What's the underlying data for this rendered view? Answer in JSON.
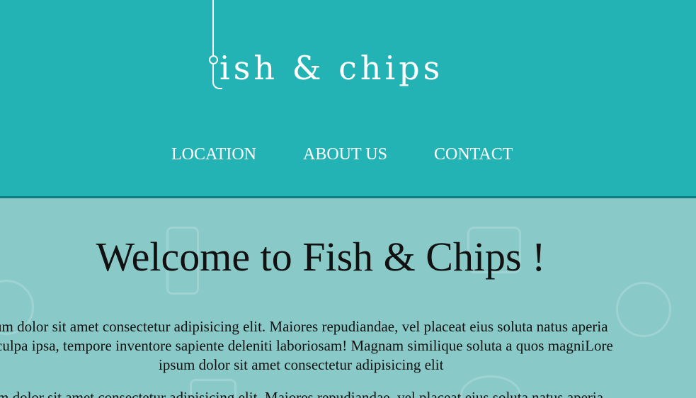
{
  "header": {
    "logo_text": "ish & chips",
    "brand_color": "#24b3b5",
    "border_color": "#137c80"
  },
  "nav": {
    "items": [
      {
        "label": "LOCATION"
      },
      {
        "label": "ABOUT US"
      },
      {
        "label": "CONTACT"
      }
    ]
  },
  "main": {
    "background_color": "#89cac8",
    "title": "Welcome to Fish & Chips !",
    "paragraph_lines": [
      "um dolor sit amet consectetur adipisicing elit. Maiores repudiandae, vel placeat eius soluta natus aperia",
      "culpa ipsa, tempore inventore sapiente deleniti laboriosam! Magnam similique soluta a quos magniLore",
      "ipsum dolor sit amet consectetur adipisicing elit",
      "m dolor sit amet consectetur adipisicing elit. Maiores repudiandae, vel placeat eius soluta natus aperia"
    ]
  }
}
